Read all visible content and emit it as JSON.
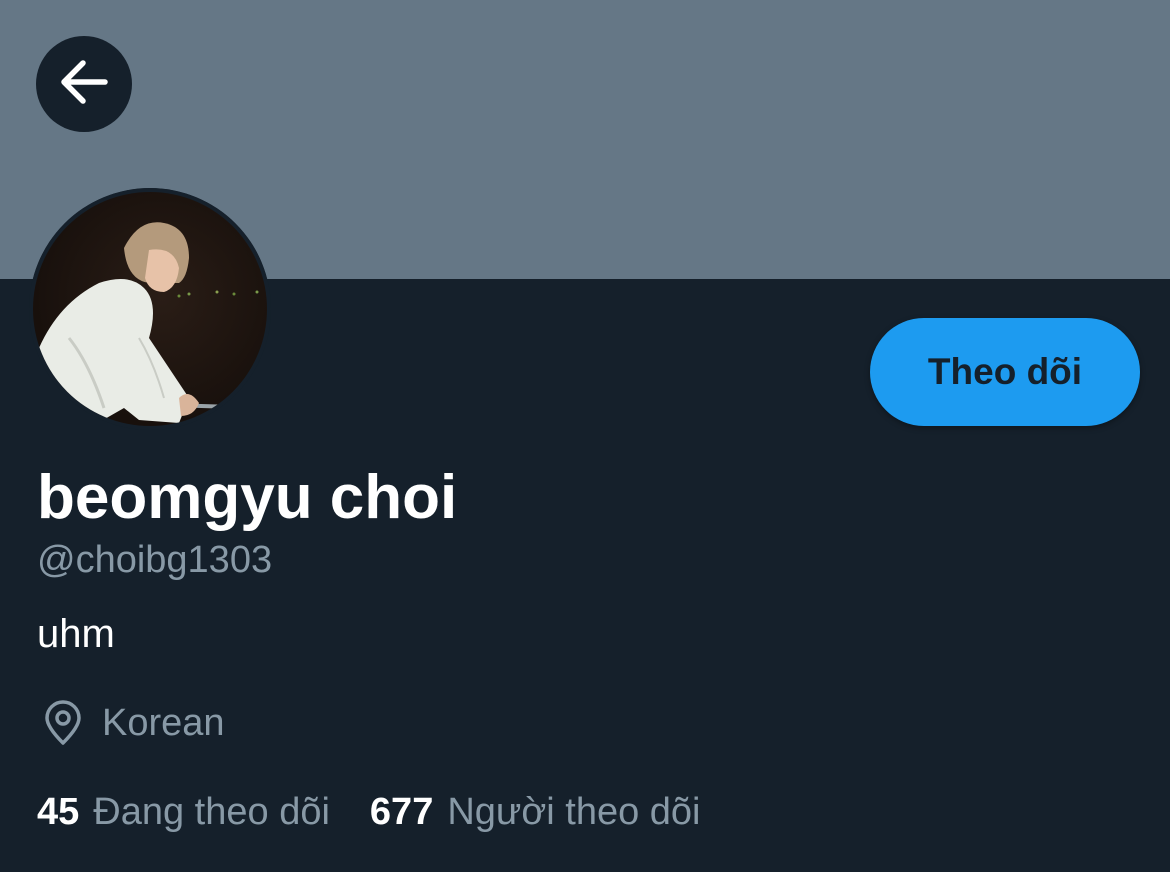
{
  "header": {
    "back_icon": "arrow-left-icon"
  },
  "profile": {
    "avatar_alt": "",
    "follow_label": "Theo dõi",
    "display_name": "beomgyu choi",
    "handle": "@choibg1303",
    "bio": "uhm",
    "location_icon": "map-pin-icon",
    "location": "Korean",
    "following_count": "45",
    "following_label": "Đang theo dõi",
    "followers_count": "677",
    "followers_label": "Người theo dõi"
  },
  "colors": {
    "background": "#15202b",
    "banner": "#657786",
    "accent": "#1d9bf0",
    "secondary_text": "#8899a6",
    "primary_text": "#ffffff"
  }
}
